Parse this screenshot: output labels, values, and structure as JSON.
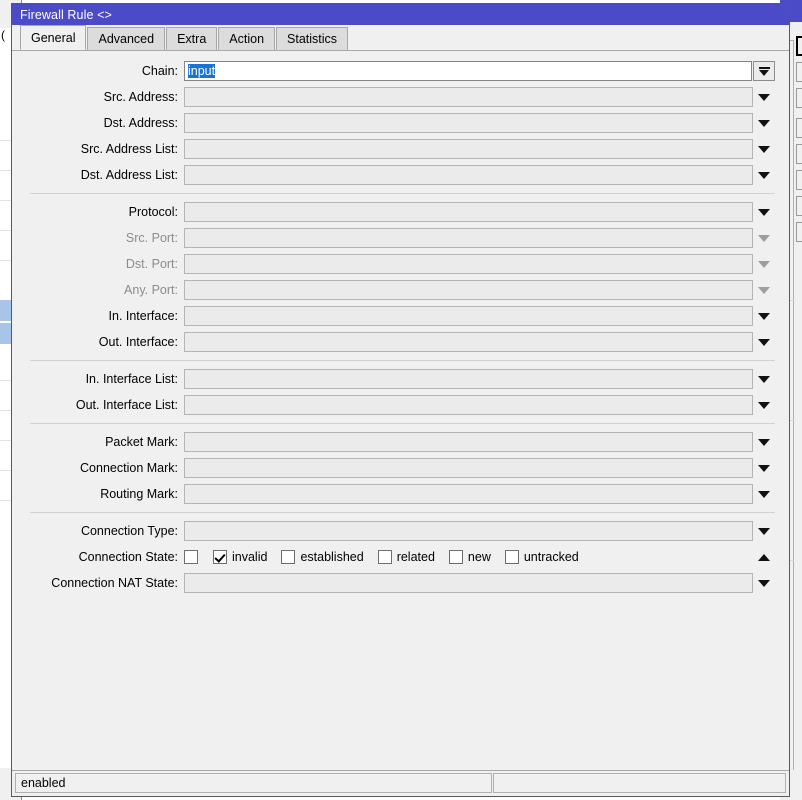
{
  "window": {
    "title": "Firewall Rule <>",
    "title_bar_color": "#4b4bc8"
  },
  "tabs": [
    {
      "label": "General",
      "active": true
    },
    {
      "label": "Advanced",
      "active": false
    },
    {
      "label": "Extra",
      "active": false
    },
    {
      "label": "Action",
      "active": false
    },
    {
      "label": "Statistics",
      "active": false
    }
  ],
  "form": {
    "chain": {
      "label": "Chain:",
      "value": "input",
      "selected": true,
      "enabled": true
    },
    "sections": [
      {
        "fields": [
          {
            "label": "Src. Address:",
            "value": "",
            "enabled": true,
            "arrow": "down"
          },
          {
            "label": "Dst. Address:",
            "value": "",
            "enabled": true,
            "arrow": "down"
          },
          {
            "label": "Src. Address List:",
            "value": "",
            "enabled": true,
            "arrow": "down"
          },
          {
            "label": "Dst. Address List:",
            "value": "",
            "enabled": true,
            "arrow": "down"
          }
        ]
      },
      {
        "fields": [
          {
            "label": "Protocol:",
            "value": "",
            "enabled": true,
            "arrow": "down"
          },
          {
            "label": "Src. Port:",
            "value": "",
            "enabled": false,
            "arrow": "down"
          },
          {
            "label": "Dst. Port:",
            "value": "",
            "enabled": false,
            "arrow": "down"
          },
          {
            "label": "Any. Port:",
            "value": "",
            "enabled": false,
            "arrow": "down"
          },
          {
            "label": "In. Interface:",
            "value": "",
            "enabled": true,
            "arrow": "down"
          },
          {
            "label": "Out. Interface:",
            "value": "",
            "enabled": true,
            "arrow": "down"
          }
        ]
      },
      {
        "fields": [
          {
            "label": "In. Interface List:",
            "value": "",
            "enabled": true,
            "arrow": "down"
          },
          {
            "label": "Out. Interface List:",
            "value": "",
            "enabled": true,
            "arrow": "down"
          }
        ]
      },
      {
        "fields": [
          {
            "label": "Packet Mark:",
            "value": "",
            "enabled": true,
            "arrow": "down"
          },
          {
            "label": "Connection Mark:",
            "value": "",
            "enabled": true,
            "arrow": "down"
          },
          {
            "label": "Routing Mark:",
            "value": "",
            "enabled": true,
            "arrow": "down"
          }
        ]
      }
    ],
    "connection_type": {
      "label": "Connection Type:",
      "value": "",
      "enabled": true,
      "arrow": "down"
    },
    "connection_state": {
      "label": "Connection State:",
      "arrow": "up",
      "negate": {
        "checked": false
      },
      "options": [
        {
          "label": "invalid",
          "checked": true
        },
        {
          "label": "established",
          "checked": false
        },
        {
          "label": "related",
          "checked": false
        },
        {
          "label": "new",
          "checked": false
        },
        {
          "label": "untracked",
          "checked": false
        }
      ]
    },
    "connection_nat_state": {
      "label": "Connection NAT State:",
      "value": "",
      "enabled": true,
      "arrow": "down"
    }
  },
  "statusbar": {
    "left": "enabled",
    "right": ""
  },
  "icons": {
    "chain_dropdown": "combo-dropdown-icon",
    "dropdown": "chevron-down-icon",
    "collapse": "chevron-up-icon"
  }
}
